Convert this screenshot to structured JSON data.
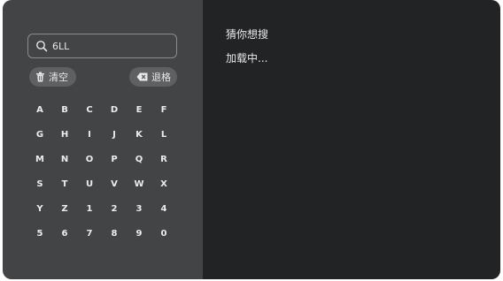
{
  "search": {
    "value": "6LL",
    "icon": "search-icon"
  },
  "actions": {
    "clear_label": "清空",
    "clear_icon": "trash-icon",
    "backspace_label": "退格",
    "backspace_icon": "backspace-icon"
  },
  "keyboard": {
    "keys": [
      "A",
      "B",
      "C",
      "D",
      "E",
      "F",
      "G",
      "H",
      "I",
      "J",
      "K",
      "L",
      "M",
      "N",
      "O",
      "P",
      "Q",
      "R",
      "S",
      "T",
      "U",
      "V",
      "W",
      "X",
      "Y",
      "Z",
      "1",
      "2",
      "3",
      "4",
      "5",
      "6",
      "7",
      "8",
      "9",
      "0"
    ]
  },
  "suggestions": {
    "title": "猜你想搜",
    "status": "加载中..."
  },
  "colors": {
    "left_panel": "#424446",
    "right_panel": "#212325",
    "pill": "#5e6062",
    "text": "#e8e8e8"
  }
}
